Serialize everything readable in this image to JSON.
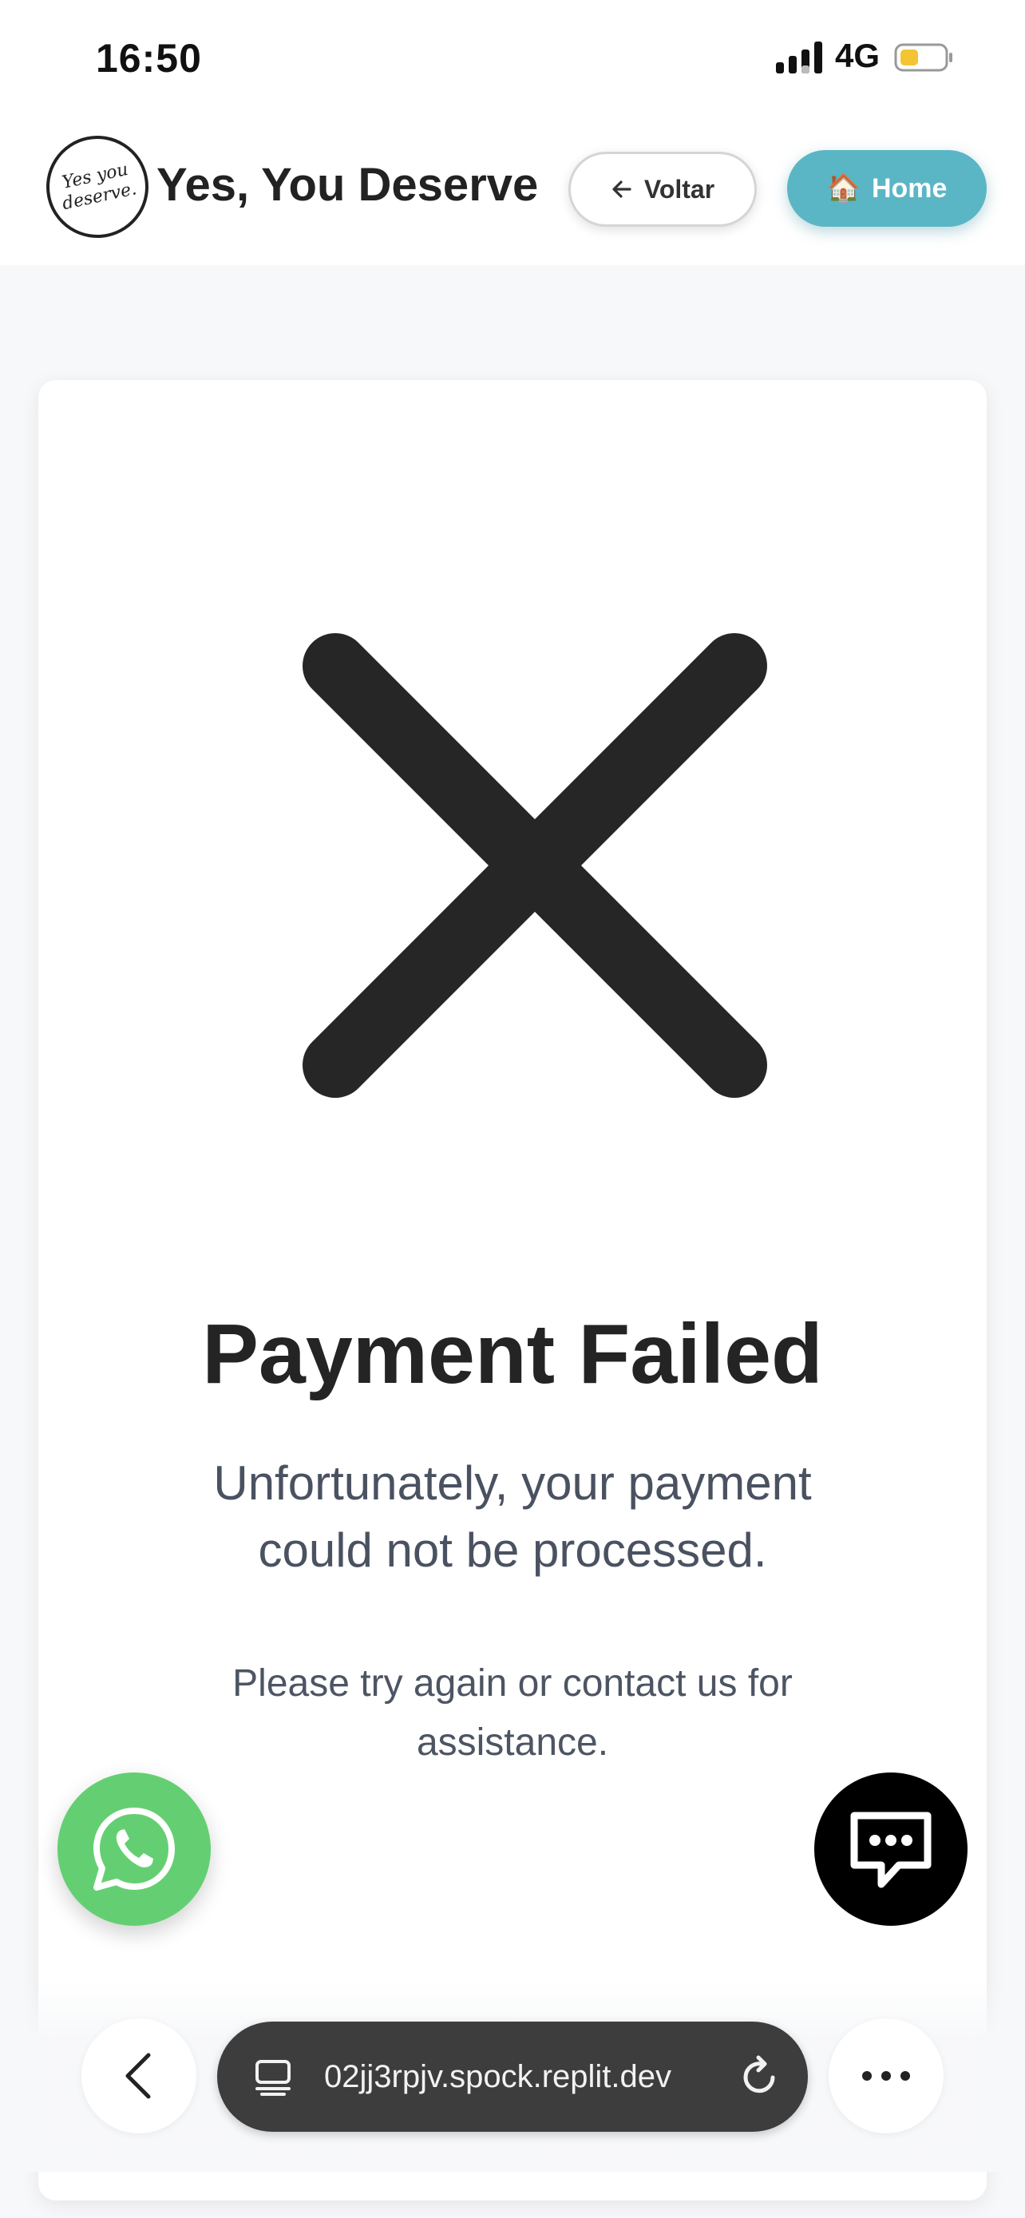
{
  "status_bar": {
    "time": "16:50",
    "network": "4G",
    "battery_color": "#f3c533"
  },
  "header": {
    "logo_text": "Yes you deserve.",
    "brand": "Yes, You Deserve",
    "back_button": {
      "icon": "arrow-left-icon",
      "label": "Voltar"
    },
    "home_button": {
      "icon": "house-icon",
      "emoji": "🏠",
      "label": "Home",
      "color": "#5ab6c5"
    }
  },
  "card": {
    "icon": "x-mark-icon",
    "title": "Payment Failed",
    "subtitle": "Unfortunately, your payment could not be processed.",
    "help_text": "Please try again or contact us for assistance."
  },
  "floating": {
    "whatsapp": {
      "icon": "whatsapp-icon",
      "color": "#64cf72"
    },
    "chat": {
      "icon": "chat-bubble-icon",
      "color": "#000000"
    }
  },
  "browser": {
    "url": "02jj3rpjv.spock.replit.dev",
    "tab_icon": "tab-overview-icon",
    "reload_icon": "reload-icon",
    "back_icon": "chevron-left-icon",
    "more_icon": "more-icon"
  }
}
